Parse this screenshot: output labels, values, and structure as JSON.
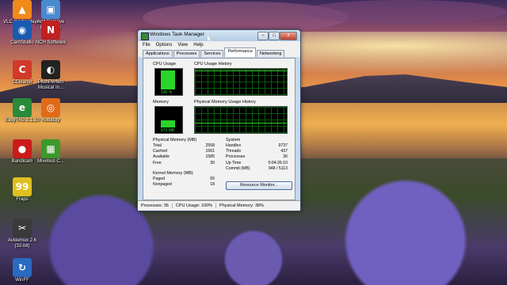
{
  "desktop": {
    "icons": [
      {
        "label": "VLC media player",
        "icon": "vlc-icon",
        "color": "#f08a1a",
        "glyph": "▲"
      },
      {
        "label": "Add Remove Programs",
        "icon": "programs-icon",
        "color": "#4a8ad0",
        "glyph": "▣"
      },
      {
        "label": "CamStudio",
        "icon": "camstudio-icon",
        "color": "#1a5ab0",
        "glyph": "◉"
      },
      {
        "label": "NCH Software",
        "icon": "nch-icon",
        "color": "#c02020",
        "glyph": "N"
      },
      {
        "label": "CCleaner",
        "icon": "ccleaner-icon",
        "color": "#d03a2a",
        "glyph": "C"
      },
      {
        "label": "PitchPerfect Musical In...",
        "icon": "tuner-icon",
        "color": "#222222",
        "glyph": "◐"
      },
      {
        "label": "EasyTAG 2.1.10",
        "icon": "easytag-icon",
        "color": "#2a8a3a",
        "glyph": "e"
      },
      {
        "label": "Audacity",
        "icon": "audacity-icon",
        "color": "#e06a1a",
        "glyph": "◎"
      },
      {
        "label": "Bandicam",
        "icon": "bandicam-icon",
        "color": "#cc1a1a",
        "glyph": "●"
      },
      {
        "label": "Mivetest-C...",
        "icon": "mivetest-icon",
        "color": "#3a9a2a",
        "glyph": "▦"
      },
      {
        "label": "Fraps",
        "icon": "fraps-icon",
        "color": "#e0c020",
        "glyph": "99"
      },
      {
        "label": "Avidemux 2.6 (32-bit)",
        "icon": "avidemux-icon",
        "color": "#3a3a3a",
        "glyph": "✂"
      },
      {
        "label": "WinFF",
        "icon": "winff-icon",
        "color": "#2a6ac0",
        "glyph": "↻"
      }
    ]
  },
  "window": {
    "title": "Windows Task Manager",
    "controls": {
      "minimize": "–",
      "maximize": "□",
      "close": "x"
    },
    "menu": [
      "File",
      "Options",
      "View",
      "Help"
    ],
    "tabs": [
      "Applications",
      "Processes",
      "Services",
      "Performance",
      "Networking"
    ],
    "active_tab": "Performance",
    "cpu_usage": {
      "label": "CPU Usage",
      "value": "100 %",
      "fill": 1.0
    },
    "cpu_history": {
      "label": "CPU Usage History"
    },
    "memory": {
      "label": "Memory",
      "value": "973 MB",
      "fill": 0.38
    },
    "memory_history": {
      "label": "Physical Memory Usage History"
    },
    "physical_memory": {
      "heading": "Physical Memory (MB)",
      "rows": [
        {
          "k": "Total",
          "v": "2558"
        },
        {
          "k": "Cached",
          "v": "1561"
        },
        {
          "k": "Available",
          "v": "1585"
        },
        {
          "k": "Free",
          "v": "30"
        }
      ]
    },
    "kernel_memory": {
      "heading": "Kernel Memory (MB)",
      "rows": [
        {
          "k": "Paged",
          "v": "65"
        },
        {
          "k": "Nonpaged",
          "v": "18"
        }
      ]
    },
    "system": {
      "heading": "System",
      "rows": [
        {
          "k": "Handles",
          "v": "9737"
        },
        {
          "k": "Threads",
          "v": "437"
        },
        {
          "k": "Processes",
          "v": "36"
        },
        {
          "k": "Up Time",
          "v": "0:04:26:10"
        },
        {
          "k": "Commit (MB)",
          "v": "948 / 5113"
        }
      ]
    },
    "resource_monitor_button": "Resource Monitor...",
    "status": {
      "processes": "Processes: 36",
      "cpu": "CPU Usage: 100%",
      "memory": "Physical Memory: 38%"
    }
  },
  "colors": {
    "meter_green": "#2bd42b",
    "grid_green": "#0a5a0a"
  }
}
